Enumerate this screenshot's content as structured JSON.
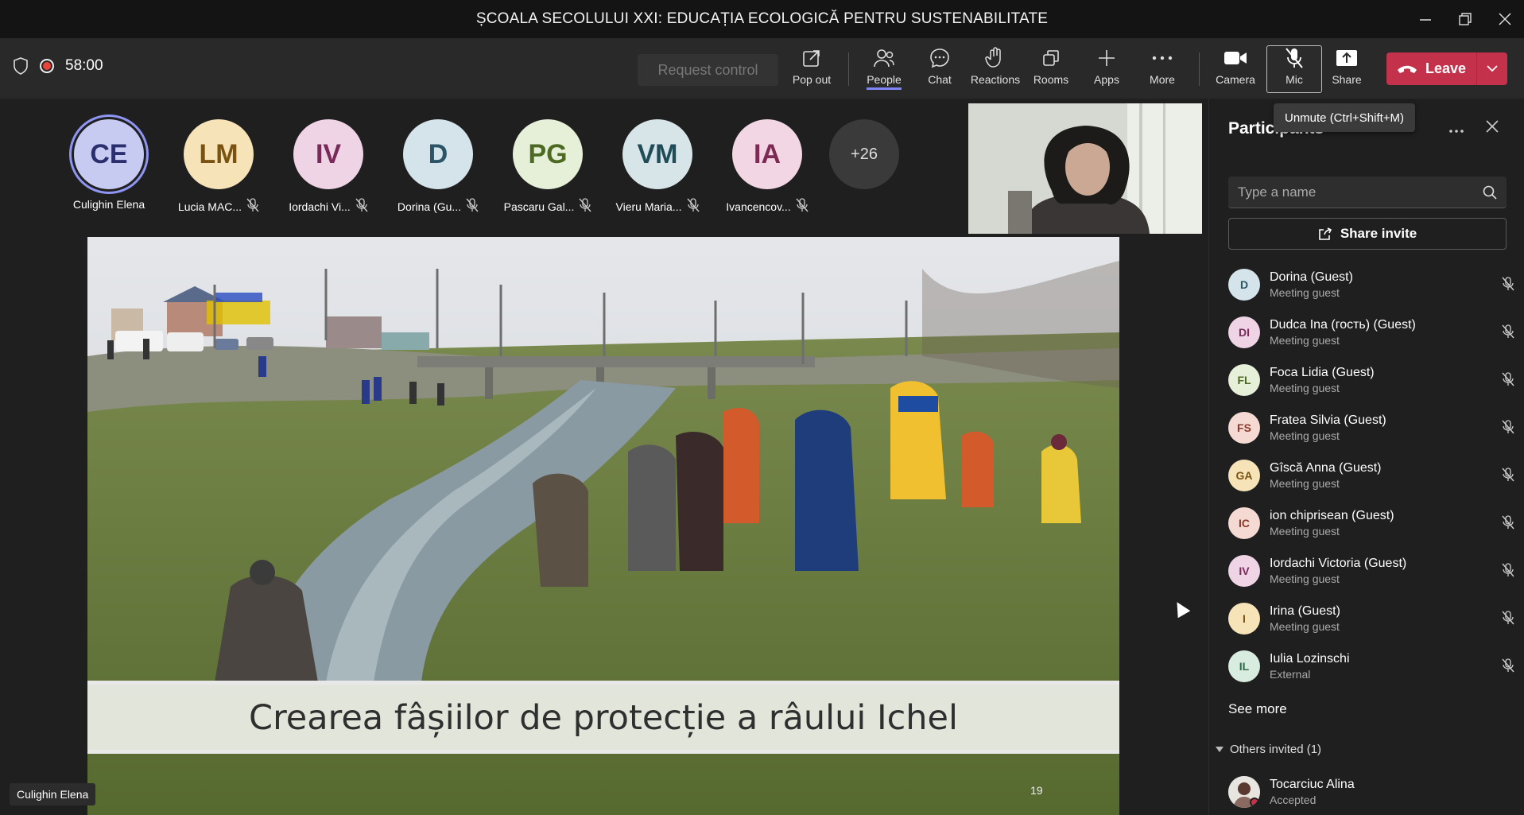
{
  "window": {
    "title": "ȘCOALA SECOLULUI XXI: EDUCAȚIA ECOLOGICĂ PENTRU SUSTENABILITATE"
  },
  "toolbar": {
    "timer": "58:00",
    "request_control": "Request control",
    "buttons": {
      "popout": "Pop out",
      "people": "People",
      "chat": "Chat",
      "reactions": "Reactions",
      "rooms": "Rooms",
      "apps": "Apps",
      "more": "More",
      "camera": "Camera",
      "mic": "Mic",
      "share": "Share"
    },
    "leave": "Leave",
    "mic_tooltip": "Unmute (Ctrl+Shift+M)"
  },
  "stage": {
    "participants": [
      {
        "initials": "CE",
        "name": "Culighin Elena",
        "color": "#c7cbf2",
        "text_color": "#2b2f6e",
        "muted": false,
        "speaking": true
      },
      {
        "initials": "LM",
        "name": "Lucia MAC...",
        "color": "#f7e3b8",
        "text_color": "#7a5312",
        "muted": true
      },
      {
        "initials": "IV",
        "name": "Iordachi Vi...",
        "color": "#efd4e6",
        "text_color": "#7a2a5a",
        "muted": true
      },
      {
        "initials": "D",
        "name": "Dorina (Gu...",
        "color": "#d4e4ea",
        "text_color": "#2b5566",
        "muted": true
      },
      {
        "initials": "PG",
        "name": "Pascaru Gal...",
        "color": "#e6efd8",
        "text_color": "#4c6a22",
        "muted": true
      },
      {
        "initials": "VM",
        "name": "Vieru Maria...",
        "color": "#d8e5e8",
        "text_color": "#1f4c58",
        "muted": true
      },
      {
        "initials": "IA",
        "name": "Ivancencov...",
        "color": "#f2d6e4",
        "text_color": "#7d2a55",
        "muted": true
      }
    ],
    "overflow_count": "+26",
    "slide_caption": "Crearea fâșiilor de protecție a râului Ichel",
    "slide_number": "19",
    "presenter_label": "Culighin Elena"
  },
  "panel": {
    "title": "Participants",
    "search_placeholder": "Type a name",
    "share_invite": "Share invite",
    "participants": [
      {
        "initials": "D",
        "name": "Dorina (Guest)",
        "role": "Meeting guest",
        "bg": "#d4e4ea",
        "fg": "#2b5566"
      },
      {
        "initials": "DI",
        "name": "Dudca Ina (гость) (Guest)",
        "role": "Meeting guest",
        "bg": "#efd4e6",
        "fg": "#7a2a5a"
      },
      {
        "initials": "FL",
        "name": "Foca Lidia (Guest)",
        "role": "Meeting guest",
        "bg": "#e6efd8",
        "fg": "#4c6a22"
      },
      {
        "initials": "FS",
        "name": "Fratea Silvia (Guest)",
        "role": "Meeting guest",
        "bg": "#f5d9d3",
        "fg": "#8a3a28"
      },
      {
        "initials": "GA",
        "name": "Gîscă Anna (Guest)",
        "role": "Meeting guest",
        "bg": "#f7e3b8",
        "fg": "#7a5312"
      },
      {
        "initials": "IC",
        "name": "ion chiprisean (Guest)",
        "role": "Meeting guest",
        "bg": "#f5d9d3",
        "fg": "#8a3a28"
      },
      {
        "initials": "IV",
        "name": "Iordachi Victoria (Guest)",
        "role": "Meeting guest",
        "bg": "#efd4e6",
        "fg": "#7a2a5a"
      },
      {
        "initials": "I",
        "name": "Irina (Guest)",
        "role": "Meeting guest",
        "bg": "#f7e3b8",
        "fg": "#7a5312"
      },
      {
        "initials": "IL",
        "name": "Iulia Lozinschi",
        "role": "External",
        "bg": "#d8ece0",
        "fg": "#2f6a47"
      }
    ],
    "see_more": "See more",
    "others_invited": "Others invited (1)",
    "invited": {
      "name": "Tocarciuc Alina",
      "status": "Accepted"
    }
  }
}
